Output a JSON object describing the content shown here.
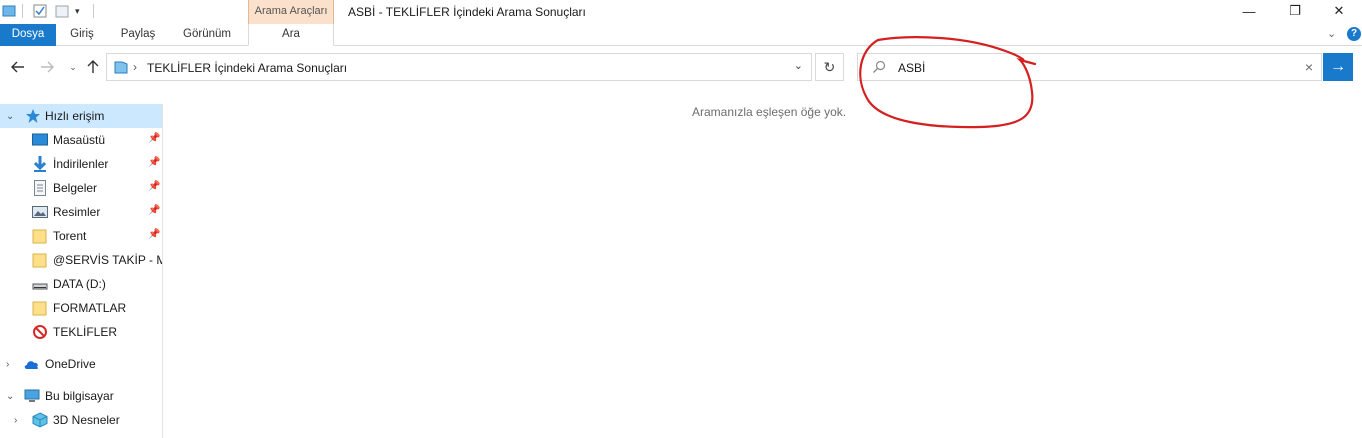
{
  "window": {
    "title": "ASBİ - TEKLİFLER İçindeki Arama Sonuçları",
    "contextual_group": "Arama Araçları",
    "controls": {
      "minimize": "—",
      "maximize": "❐",
      "close": "✕"
    }
  },
  "ribbon": {
    "tabs": [
      {
        "label": "Dosya"
      },
      {
        "label": "Giriş"
      },
      {
        "label": "Paylaş"
      },
      {
        "label": "Görünüm"
      },
      {
        "label": "Ara"
      }
    ]
  },
  "address": {
    "path": "TEKLİFLER İçindeki Arama Sonuçları",
    "separator": "›"
  },
  "search": {
    "value": "ASBİ"
  },
  "content": {
    "empty_message": "Aramanızla eşleşen öğe yok."
  },
  "nav_pane": {
    "items": [
      {
        "label": "Hızlı erişim",
        "icon": "star-icon"
      },
      {
        "label": "Masaüstü",
        "icon": "desktop-icon"
      },
      {
        "label": "İndirilenler",
        "icon": "download-icon"
      },
      {
        "label": "Belgeler",
        "icon": "documents-icon"
      },
      {
        "label": "Resimler",
        "icon": "pictures-icon"
      },
      {
        "label": "Torent",
        "icon": "folder-icon"
      },
      {
        "label": "@SERVİS TAKİP - MA",
        "icon": "folder-icon"
      },
      {
        "label": "DATA (D:)",
        "icon": "drive-icon"
      },
      {
        "label": "FORMATLAR",
        "icon": "folder-icon"
      },
      {
        "label": "TEKLİFLER",
        "icon": "blocked-icon"
      },
      {
        "label": "OneDrive",
        "icon": "cloud-icon"
      },
      {
        "label": "Bu bilgisayar",
        "icon": "computer-icon"
      },
      {
        "label": "3D Nesneler",
        "icon": "3d-objects-icon"
      }
    ]
  },
  "colors": {
    "accent": "#1979ca",
    "selection": "#cce8ff",
    "contextual_tab": "#fbe1cc",
    "annotation": "#d42020"
  }
}
